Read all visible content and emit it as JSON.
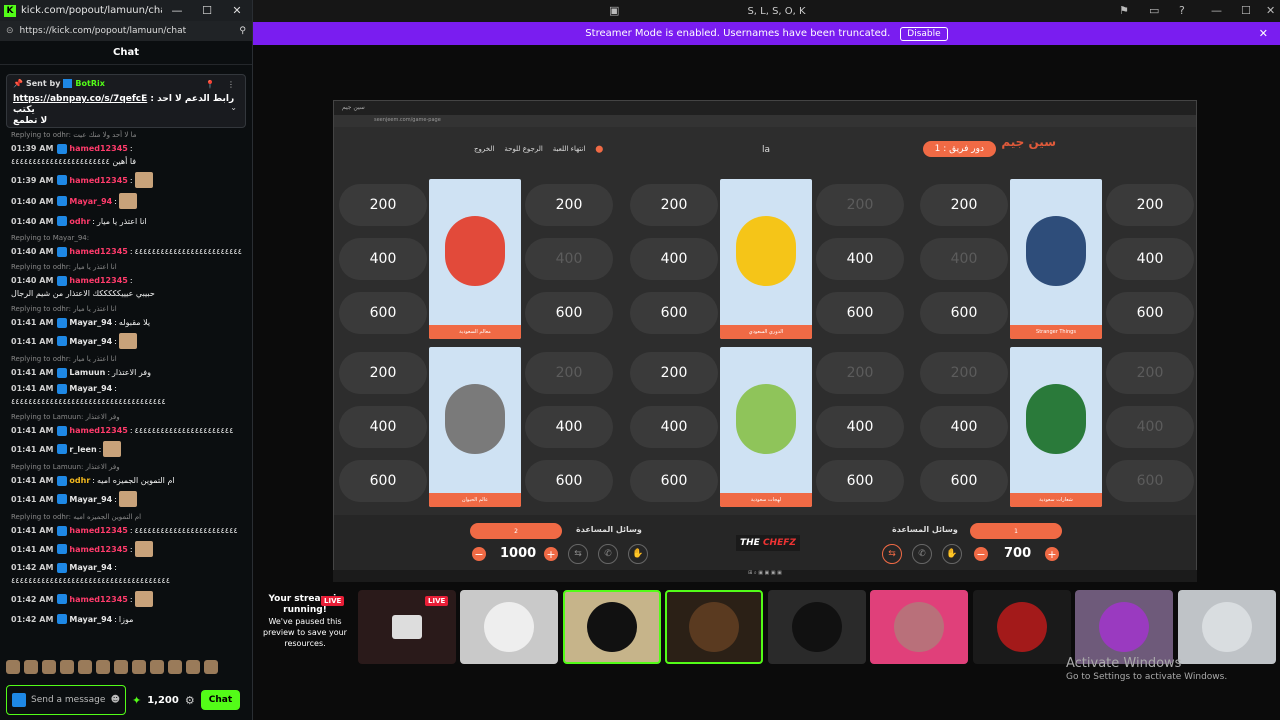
{
  "browser": {
    "title": "kick.com/popout/lamuun/chat -...",
    "url": "https://kick.com/popout/lamuun/chat",
    "min": "—",
    "max": "☐",
    "close": "✕"
  },
  "chat": {
    "header": "Chat",
    "pinned": {
      "sent_by": "Sent by",
      "bot": "BotRix",
      "message_link": "https://abnpay.co/s/7qefcE",
      "message_text": ": رابط الدعم لا احد يكتب",
      "message_text2": "لا تطمع"
    },
    "messages": [
      {
        "reply": "Replying to odhr: ما لا أحد ولا منك عيت",
        "time": "01:39 AM",
        "user": "hamed12345",
        "color": "#ff3b6b",
        "text": "فا أهين ٤٤٤٤٤٤٤٤٤٤٤٤٤٤٤٤٤٤٤٤٤٤٤"
      },
      {
        "reply": "",
        "time": "01:39 AM",
        "user": "hamed12345",
        "color": "#ff3b6b",
        "text": ""
      },
      {
        "reply": "",
        "time": "01:40 AM",
        "user": "Mayar_94",
        "color": "#ff3b6b",
        "text": ""
      },
      {
        "reply": "",
        "time": "01:40 AM",
        "user": "odhr",
        "color": "#ff3b6b",
        "text": "انا اعتذر يا ميار"
      },
      {
        "reply": "Replying to Mayar_94:",
        "time": "01:40 AM",
        "user": "hamed12345",
        "color": "#ff3b6b",
        "text": "٤٤٤٤٤٤٤٤٤٤٤٤٤٤٤٤٤٤٤٤٤٤٤٤٤"
      },
      {
        "reply": "Replying to odhr: انا اعتذر يا ميار",
        "time": "01:40 AM",
        "user": "hamed12345",
        "color": "#ff3b6b",
        "text": "حبيبي عيييكككككك الاعتذار من شيم الرجال"
      },
      {
        "reply": "Replying to odhr: انا اعتذر يا ميار",
        "time": "01:41 AM",
        "user": "Mayar_94",
        "color": "#e6e6e6",
        "text": "يلا مقبوله"
      },
      {
        "reply": "",
        "time": "01:41 AM",
        "user": "Mayar_94",
        "color": "#e6e6e6",
        "text": ""
      },
      {
        "reply": "Replying to odhr: انا اعتذر يا ميار",
        "time": "01:41 AM",
        "user": "Lamuun",
        "color": "#e6e6e6",
        "text": "وفر الاعتذار"
      },
      {
        "reply": "",
        "time": "01:41 AM",
        "user": "Mayar_94",
        "color": "#e6e6e6",
        "text": "٤٤٤٤٤٤٤٤٤٤٤٤٤٤٤٤٤٤٤٤٤٤٤٤٤٤٤٤٤٤٤٤٤٤٤٤"
      },
      {
        "reply": "Replying to Lamuun: وفر الاعتذار",
        "time": "01:41 AM",
        "user": "hamed12345",
        "color": "#ff3b6b",
        "text": "٤٤٤٤٤٤٤٤٤٤٤٤٤٤٤٤٤٤٤٤٤٤٤"
      },
      {
        "reply": "",
        "time": "01:41 AM",
        "user": "r_leen",
        "color": "#e6e6e6",
        "text": ""
      },
      {
        "reply": "Replying to Lamuun: وفر الاعتذار",
        "time": "01:41 AM",
        "user": "odhr",
        "color": "#f2b81e",
        "text": "ام التموين الجميزه اميه"
      },
      {
        "reply": "",
        "time": "01:41 AM",
        "user": "Mayar_94",
        "color": "#e6e6e6",
        "text": ""
      },
      {
        "reply": "Replying to odhr: ام التموين الجميزه اميه",
        "time": "01:41 AM",
        "user": "hamed12345",
        "color": "#ff3b6b",
        "text": "٤٤٤٤٤٤٤٤٤٤٤٤٤٤٤٤٤٤٤٤٤٤٤٤"
      },
      {
        "reply": "",
        "time": "01:41 AM",
        "user": "hamed12345",
        "color": "#ff3b6b",
        "text": ""
      },
      {
        "reply": "",
        "time": "01:42 AM",
        "user": "Mayar_94",
        "color": "#e6e6e6",
        "text": "٤٤٤٤٤٤٤٤٤٤٤٤٤٤٤٤٤٤٤٤٤٤٤٤٤٤٤٤٤٤٤٤٤٤٤٤٤"
      },
      {
        "reply": "",
        "time": "01:42 AM",
        "user": "hamed12345",
        "color": "#ff3b6b",
        "text": ""
      },
      {
        "reply": "",
        "time": "01:42 AM",
        "user": "Mayar_94",
        "color": "#e6e6e6",
        "text": "موزا"
      }
    ],
    "send_placeholder": "Send a message",
    "points": "1,200",
    "chat_button": "Chat"
  },
  "main": {
    "window_title": "S, L, S, O, K",
    "banner": {
      "text": "Streamer Mode is enabled. Usernames have been truncated.",
      "button": "Disable"
    },
    "game": {
      "tab": "سين جيم",
      "url": "seenjeem.com/game-page",
      "logo": "سين جيم",
      "team_turn": "دور فريق : 1",
      "answer": "la",
      "controls": [
        "انتهاء اللعبة",
        "الرجوع للوحة",
        "الخروج"
      ],
      "columns": [
        {
          "card": "معالم السعودية",
          "left": [
            "200",
            "400",
            "600"
          ],
          "right": [
            "200",
            "400",
            "600"
          ],
          "left_dim": [
            false,
            false,
            false
          ],
          "right_dim": [
            false,
            true,
            false
          ]
        },
        {
          "card": "الدوري السعودي",
          "left": [
            "200",
            "400",
            "600"
          ],
          "right": [
            "200",
            "400",
            "600"
          ],
          "left_dim": [
            false,
            false,
            false
          ],
          "right_dim": [
            true,
            false,
            false
          ]
        },
        {
          "card": "Stranger Things",
          "left": [
            "200",
            "400",
            "600"
          ],
          "right": [
            "200",
            "400",
            "600"
          ],
          "left_dim": [
            false,
            true,
            false
          ],
          "right_dim": [
            false,
            false,
            false
          ]
        },
        {
          "card": "عالم الحيوان",
          "left": [
            "200",
            "400",
            "600"
          ],
          "right": [
            "200",
            "400",
            "600"
          ],
          "left_dim": [
            false,
            false,
            false
          ],
          "right_dim": [
            true,
            false,
            false
          ]
        },
        {
          "card": "لهجات سعودية",
          "left": [
            "200",
            "400",
            "600"
          ],
          "right": [
            "200",
            "400",
            "600"
          ],
          "left_dim": [
            false,
            false,
            false
          ],
          "right_dim": [
            true,
            false,
            false
          ]
        },
        {
          "card": "شعارات سعودية",
          "left": [
            "200",
            "400",
            "600"
          ],
          "right": [
            "200",
            "400",
            "600"
          ],
          "left_dim": [
            true,
            false,
            false
          ],
          "right_dim": [
            true,
            true,
            true
          ]
        }
      ],
      "footer": {
        "left_label": "وسائل المساعدة",
        "left_team": "2",
        "left_score": "1000",
        "right_label": "وسائل المساعدة",
        "right_team": "1",
        "right_score": "700",
        "sponsor_a": "THE ",
        "sponsor_b": "CHEFZ"
      }
    },
    "paused": {
      "title": "Your stream is running!",
      "text": "We've paused this preview to save your resources.",
      "live": "LIVE"
    },
    "activate": {
      "line1": "Activate Windows",
      "line2": "Go to Settings to activate Windows."
    }
  }
}
